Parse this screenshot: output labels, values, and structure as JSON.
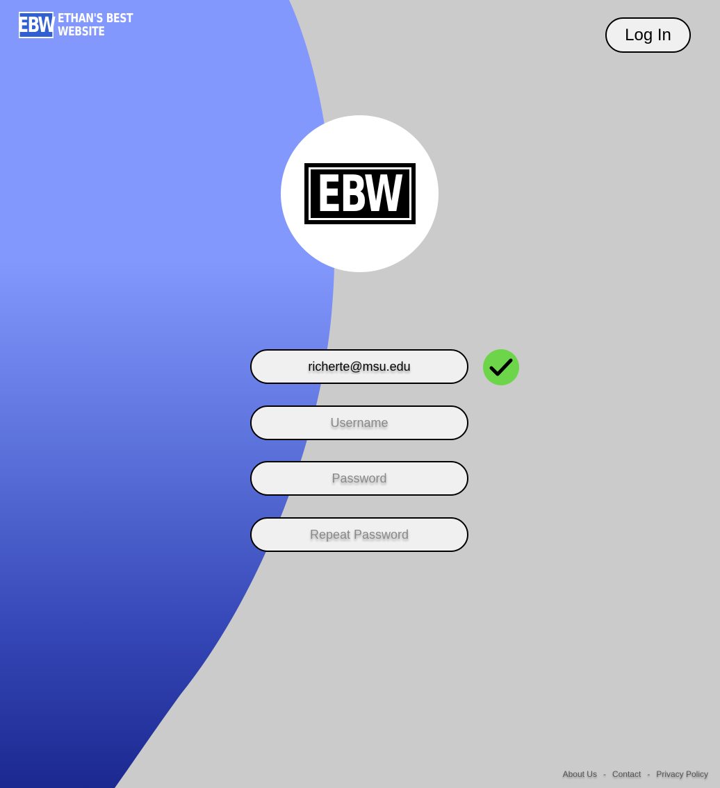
{
  "brand": {
    "abbr": "EBW",
    "line1": "ETHAN'S BEST",
    "line2": "WEBSITE"
  },
  "header": {
    "login_label": "Log In"
  },
  "center_logo": {
    "abbr": "EBW"
  },
  "form": {
    "email_value": "richerte@msu.edu",
    "username_placeholder": "Username",
    "password_placeholder": "Password",
    "repeat_password_placeholder": "Repeat Password",
    "email_status_icon": "check-icon"
  },
  "footer": {
    "about_label": "About Us",
    "contact_label": "Contact",
    "privacy_label": "Privacy Policy",
    "separator": "-"
  },
  "colors": {
    "background": "#cbcbcb",
    "gradient_top": "#8398fd",
    "gradient_bottom": "#1b2890",
    "check_green": "#6cd54a",
    "field_fill": "#f0f0f0"
  }
}
